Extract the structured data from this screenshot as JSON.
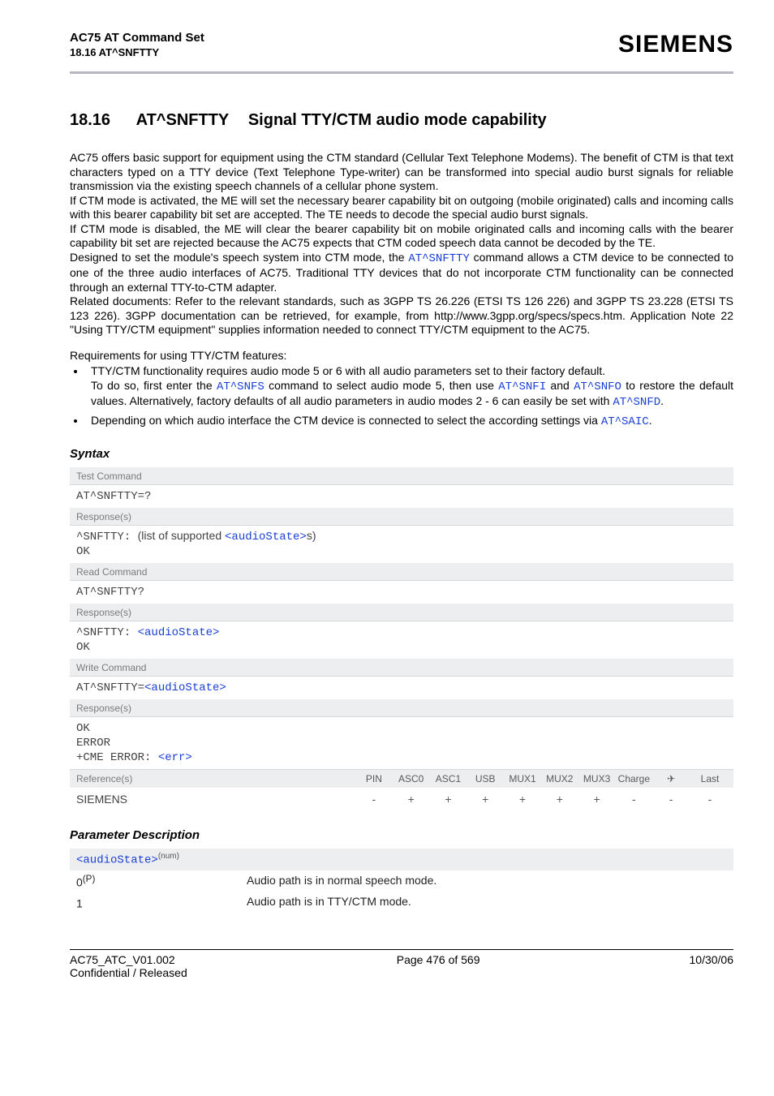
{
  "header": {
    "docTitle": "AC75 AT Command Set",
    "docSub": "18.16 AT^SNFTTY",
    "brand": "SIEMENS"
  },
  "section": {
    "num": "18.16",
    "cmd": "AT^SNFTTY",
    "title": "Signal TTY/CTM audio mode capability"
  },
  "intro": {
    "p1a": "AC75 offers basic support for equipment using the CTM standard (Cellular Text Telephone Modems). The benefit of CTM is that text characters typed on a TTY device (Text Telephone Type-writer) can be transformed into special audio burst signals for reliable transmission via the existing speech channels of a cellular phone system.",
    "p1b": "If CTM mode is activated, the ME will set the necessary bearer capability bit on outgoing (mobile originated) calls and incoming calls with this bearer capability bit set are accepted. The TE needs to decode the special audio burst signals.",
    "p1c": "If CTM mode is disabled, the ME will clear the bearer capability bit on mobile originated calls and incoming calls with the bearer capability bit set are rejected because the AC75 expects that CTM coded speech data cannot be decoded by the TE.",
    "p2a": "Designed to set the module's speech system into CTM mode, the ",
    "p2link": "AT^SNFTTY",
    "p2b": " command allows a CTM device to be connected to one of the three audio interfaces of AC75. Traditional TTY devices that do not incorporate CTM functionality can be connected through an external TTY-to-CTM adapter.",
    "p3": "Related documents: Refer to the relevant standards, such as 3GPP TS 26.226 (ETSI TS 126 226) and 3GPP TS 23.228 (ETSI TS 123 226). 3GPP documentation can be retrieved, for example, from http://www.3gpp.org/specs/specs.htm. Application Note 22 \"Using TTY/CTM equipment\" supplies information needed to connect TTY/CTM equipment to the AC75.",
    "reqHead": "Requirements for using TTY/CTM features:",
    "bullet1a": "TTY/CTM functionality requires audio mode 5 or 6 with all audio parameters set to their factory default.",
    "bullet1b_a": "To do so, first enter the ",
    "bullet1b_cmd1": "AT^SNFS",
    "bullet1b_b": " command to select audio mode 5, then use ",
    "bullet1b_cmd2": "AT^SNFI",
    "bullet1b_c": " and ",
    "bullet1b_cmd3": "AT^SNFO",
    "bullet1b_d": " to restore the default values. Alternatively, factory defaults of all audio parameters in audio modes 2 - 6 can easily be set with ",
    "bullet1b_cmd4": "AT^SNFD",
    "bullet1b_e": ".",
    "bullet2a": "Depending on which audio interface the CTM device is connected to select the according settings via ",
    "bullet2cmd": "AT^SAIC",
    "bullet2b": "."
  },
  "syntax": {
    "heading": "Syntax",
    "testLabel": "Test Command",
    "testCmd": "AT^SNFTTY=?",
    "respLabel": "Response(s)",
    "testResp_a": "^SNFTTY: ",
    "testResp_b": "(list of supported ",
    "testResp_param": "<audioState>",
    "testResp_c": "s)",
    "ok": "OK",
    "readLabel": "Read Command",
    "readCmd": "AT^SNFTTY?",
    "readResp_a": "^SNFTTY: ",
    "readResp_param": "<audioState>",
    "writeLabel": "Write Command",
    "writeCmd_a": "AT^SNFTTY=",
    "writeCmd_param": "<audioState>",
    "writeResp_ok": "OK",
    "writeResp_err": "ERROR",
    "writeResp_cme_a": "+CME ERROR: ",
    "writeResp_cme_param": "<err>",
    "refLabel": "Reference(s)",
    "refCols": [
      "PIN",
      "ASC0",
      "ASC1",
      "USB",
      "MUX1",
      "MUX2",
      "MUX3",
      "Charge",
      "✈",
      "Last"
    ],
    "refName": "SIEMENS",
    "refVals": [
      "-",
      "+",
      "+",
      "+",
      "+",
      "+",
      "+",
      "-",
      "-",
      "-"
    ]
  },
  "params": {
    "heading": "Parameter Description",
    "paramName": "<audioState>",
    "paramSup": "(num)",
    "rows": [
      {
        "val_a": "0",
        "val_sup": "(P)",
        "desc": "Audio path is in normal speech mode."
      },
      {
        "val_a": "1",
        "val_sup": "",
        "desc": "Audio path is in TTY/CTM mode."
      }
    ]
  },
  "footer": {
    "left1": "AC75_ATC_V01.002",
    "left2": "Confidential / Released",
    "center": "Page 476 of 569",
    "right": "10/30/06"
  }
}
